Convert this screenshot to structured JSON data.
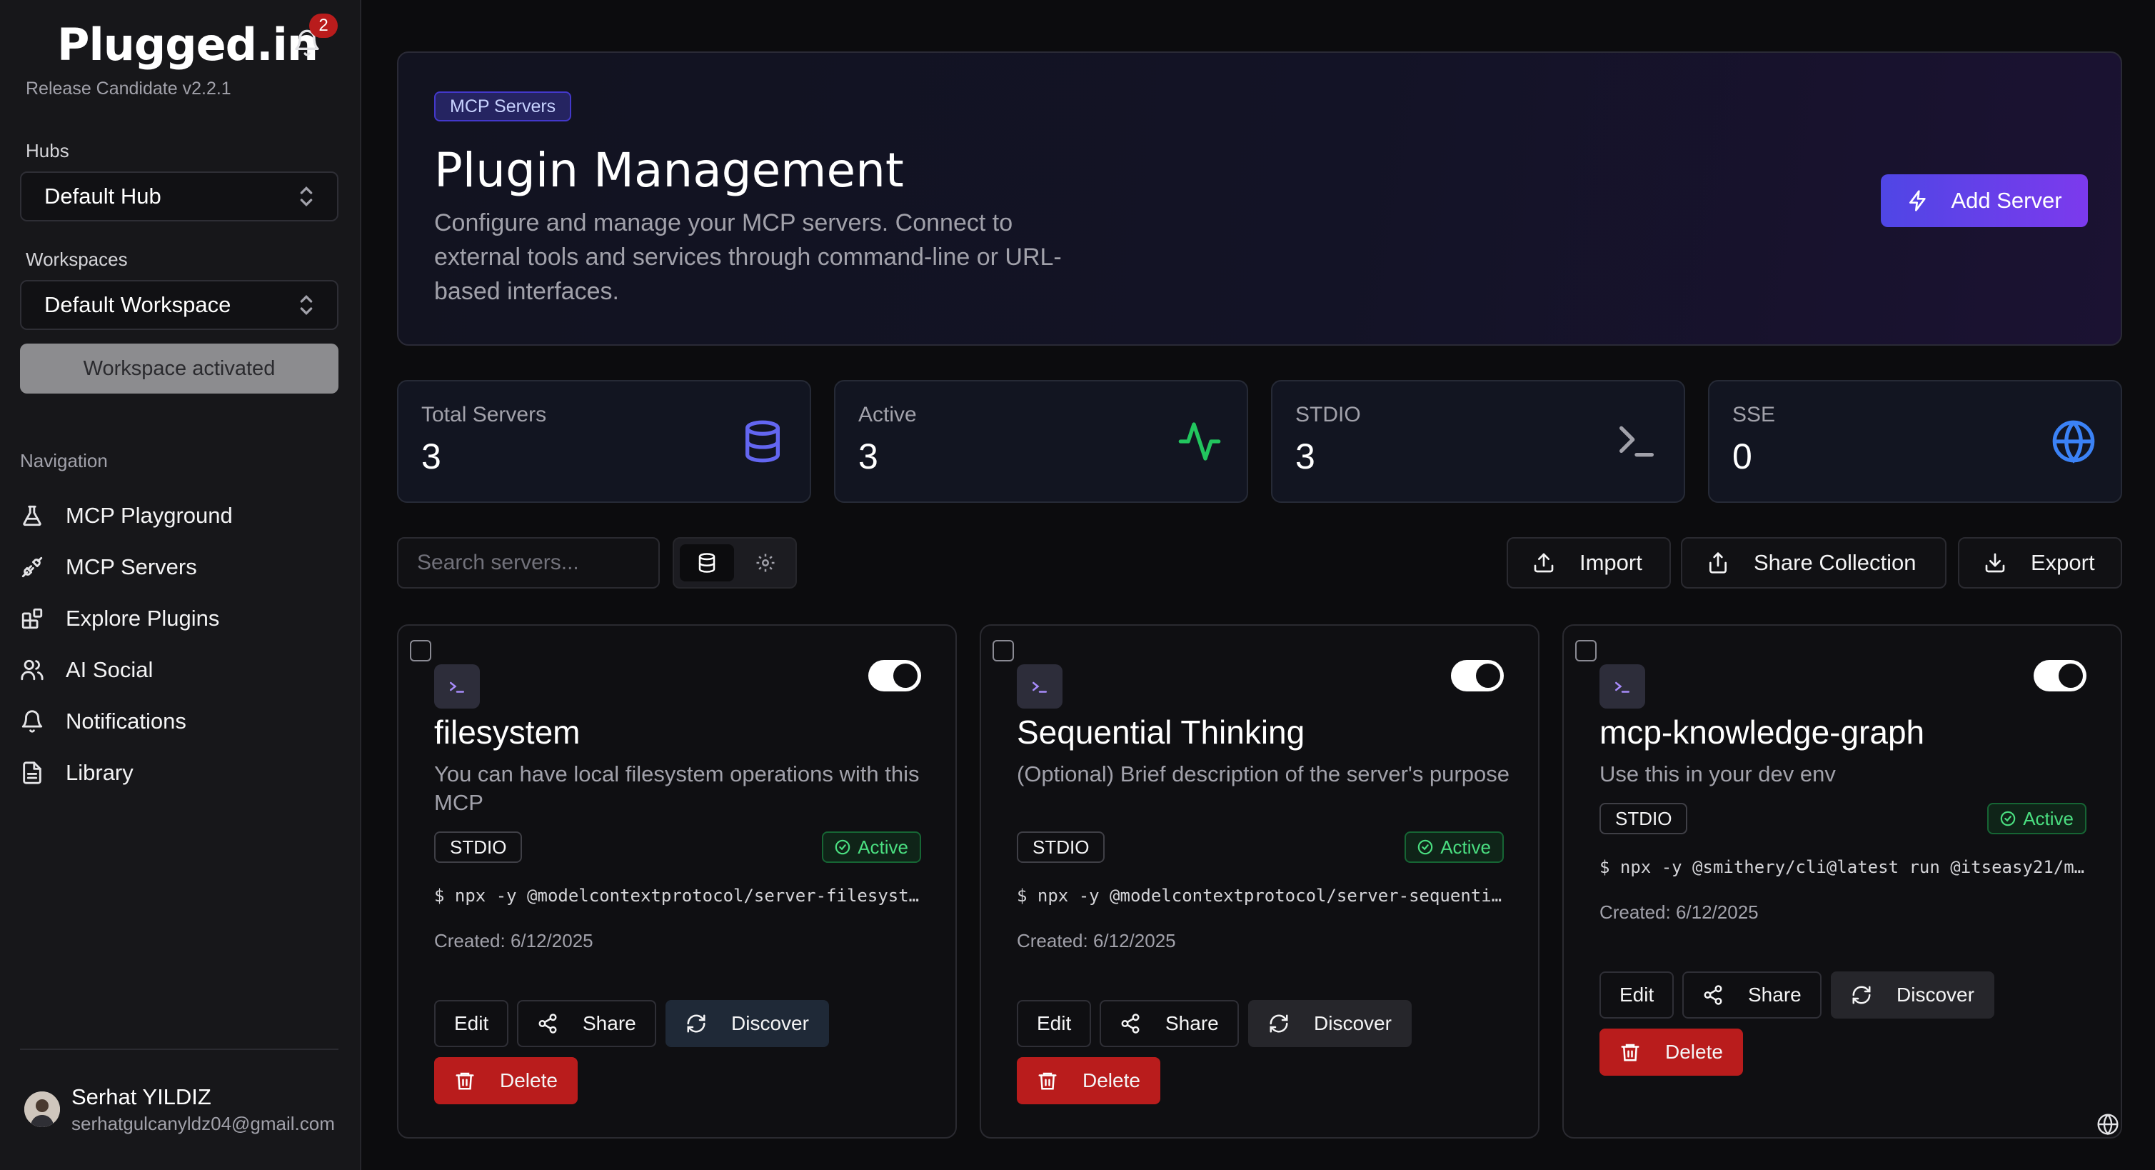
{
  "app": {
    "brand": "Plugged.in",
    "release": "Release Candidate v2.2.1",
    "notification_count": "2"
  },
  "sidebar": {
    "hubs_label": "Hubs",
    "hub_value": "Default Hub",
    "workspaces_label": "Workspaces",
    "workspace_value": "Default Workspace",
    "workspace_status": "Workspace activated",
    "nav_label": "Navigation",
    "items": [
      {
        "label": "MCP Playground",
        "icon": "flask-icon"
      },
      {
        "label": "MCP Servers",
        "icon": "plug-icon"
      },
      {
        "label": "Explore Plugins",
        "icon": "blocks-icon"
      },
      {
        "label": "AI Social",
        "icon": "users-icon"
      },
      {
        "label": "Notifications",
        "icon": "bell-icon"
      },
      {
        "label": "Library",
        "icon": "file-icon"
      }
    ],
    "user": {
      "name": "Serhat YILDIZ",
      "email": "serhatgulcanyldz04@gmail.com"
    }
  },
  "hero": {
    "badge": "MCP Servers",
    "title": "Plugin Management",
    "description": "Configure and manage your MCP servers. Connect to external tools and services through command-line or URL-based interfaces.",
    "add_button": "Add Server"
  },
  "stats": [
    {
      "label": "Total Servers",
      "value": "3",
      "icon": "database-icon",
      "color": "#6366f1"
    },
    {
      "label": "Active",
      "value": "3",
      "icon": "activity-icon",
      "color": "#22c55e"
    },
    {
      "label": "STDIO",
      "value": "3",
      "icon": "terminal-icon",
      "color": "#a1a1aa"
    },
    {
      "label": "SSE",
      "value": "0",
      "icon": "globe-icon",
      "color": "#3b82f6"
    }
  ],
  "toolbar": {
    "search_placeholder": "Search servers...",
    "import": "Import",
    "share_collection": "Share Collection",
    "export": "Export"
  },
  "servers": [
    {
      "name": "filesystem",
      "description": "You can have local filesystem operations with this MCP",
      "type": "STDIO",
      "status": "Active",
      "command": "$ npx -y @modelcontextprotocol/server-filesyst…",
      "created": "Created: 6/12/2025"
    },
    {
      "name": "Sequential Thinking",
      "description": "(Optional) Brief description of the server's purpose",
      "type": "STDIO",
      "status": "Active",
      "command": "$ npx -y @modelcontextprotocol/server-sequenti…",
      "created": "Created: 6/12/2025"
    },
    {
      "name": "mcp-knowledge-graph",
      "description": "Use this in your dev env",
      "type": "STDIO",
      "status": "Active",
      "command": "$ npx -y @smithery/cli@latest run @itseasy21/m…",
      "created": "Created: 6/12/2025"
    }
  ],
  "card_actions": {
    "edit": "Edit",
    "share": "Share",
    "discover": "Discover",
    "delete": "Delete"
  },
  "colors": {
    "accent": "#6d28d9",
    "active_green": "#4ade80",
    "danger": "#b91c1c"
  }
}
